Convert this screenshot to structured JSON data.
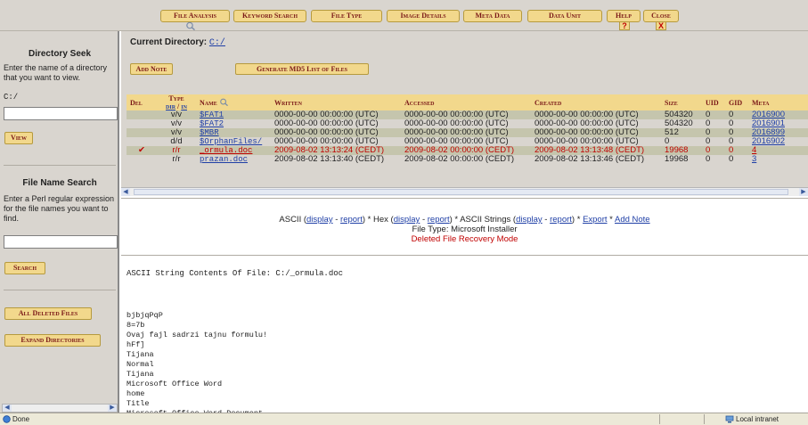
{
  "toolbar": {
    "tabs": [
      "File Analysis",
      "Keyword Search",
      "File Type",
      "Image Details",
      "Meta Data",
      "Data Unit",
      "Help",
      "Close"
    ],
    "help_glyph": "?",
    "close_glyph": "X"
  },
  "sidebar": {
    "directory_seek": {
      "title": "Directory Seek",
      "instructions": "Enter the name of a directory that you want to view.",
      "current_value": "C:/",
      "input_value": "",
      "button": "View"
    },
    "file_name_search": {
      "title": "File Name Search",
      "instructions": "Enter a Perl regular expression for the file names you want to find.",
      "input_value": "",
      "button": "Search"
    },
    "all_deleted_button": "All Deleted Files",
    "expand_dirs_button": "Expand Directories"
  },
  "directory": {
    "label": "Current Directory:",
    "path": "C:/",
    "add_note_button": "Add Note",
    "md5_button": "Generate MD5 List of Files",
    "columns": {
      "del": "Del",
      "type": "Type",
      "type_dir": "dir",
      "type_sep": " / ",
      "type_in": "in",
      "name": "Name",
      "written": "Written",
      "accessed": "Accessed",
      "created": "Created",
      "size": "Size",
      "uid": "UID",
      "gid": "GID",
      "meta": "Meta"
    },
    "rows": [
      {
        "del": "",
        "type": "v/v",
        "name": "$FAT1",
        "written": "0000-00-00 00:00:00 (UTC)",
        "accessed": "0000-00-00 00:00:00 (UTC)",
        "created": "0000-00-00 00:00:00 (UTC)",
        "size": "504320",
        "uid": "0",
        "gid": "0",
        "meta": "2016900"
      },
      {
        "del": "",
        "type": "v/v",
        "name": "$FAT2",
        "written": "0000-00-00 00:00:00 (UTC)",
        "accessed": "0000-00-00 00:00:00 (UTC)",
        "created": "0000-00-00 00:00:00 (UTC)",
        "size": "504320",
        "uid": "0",
        "gid": "0",
        "meta": "2016901"
      },
      {
        "del": "",
        "type": "v/v",
        "name": "$MBR",
        "written": "0000-00-00 00:00:00 (UTC)",
        "accessed": "0000-00-00 00:00:00 (UTC)",
        "created": "0000-00-00 00:00:00 (UTC)",
        "size": "512",
        "uid": "0",
        "gid": "0",
        "meta": "2016899"
      },
      {
        "del": "",
        "type": "d/d",
        "name": "$OrphanFiles/",
        "written": "0000-00-00 00:00:00 (UTC)",
        "accessed": "0000-00-00 00:00:00 (UTC)",
        "created": "0000-00-00 00:00:00 (UTC)",
        "size": "0",
        "uid": "0",
        "gid": "0",
        "meta": "2016902"
      },
      {
        "del": "✔",
        "type": "r/r",
        "name": "_ormula.doc",
        "written": "2009-08-02 13:13:24 (CEDT)",
        "accessed": "2009-08-02 00:00:00 (CEDT)",
        "created": "2009-08-02 13:13:48 (CEDT)",
        "size": "19968",
        "uid": "0",
        "gid": "0",
        "meta": "4"
      },
      {
        "del": "",
        "type": "r/r",
        "name": "prazan.doc",
        "written": "2009-08-02 13:13:40 (CEDT)",
        "accessed": "2009-08-02 00:00:00 (CEDT)",
        "created": "2009-08-02 13:13:46 (CEDT)",
        "size": "19968",
        "uid": "0",
        "gid": "0",
        "meta": "3"
      }
    ]
  },
  "info": {
    "ascii": "ASCII",
    "display": "display",
    "report": "report",
    "hex": "Hex",
    "ascii_strings": "ASCII Strings",
    "export": "Export",
    "add_note": "Add Note",
    "file_type": "File Type: Microsoft Installer",
    "recovery_mode": "Deleted File Recovery Mode"
  },
  "content": {
    "heading": "ASCII String Contents Of File: C:/_ormula.doc",
    "lines": [
      "bjbjqPqP",
      "8=7b",
      "Ovaj fajl sadrzi tajnu formulu!",
      "hFf]",
      "Tijana",
      "Normal",
      "Tijana",
      "Microsoft Office Word",
      "home",
      "Title",
      "Microsoft Office Word Document"
    ]
  },
  "status": {
    "left": "Done",
    "zone": "Local intranet"
  },
  "colors": {
    "button_fill": "#f2d88c",
    "button_text": "#7a1717",
    "panel_bg": "#d9d5cf",
    "row_dark": "#c5c5ad",
    "deleted_red": "#c00000",
    "link_blue": "#1f3fa6"
  }
}
